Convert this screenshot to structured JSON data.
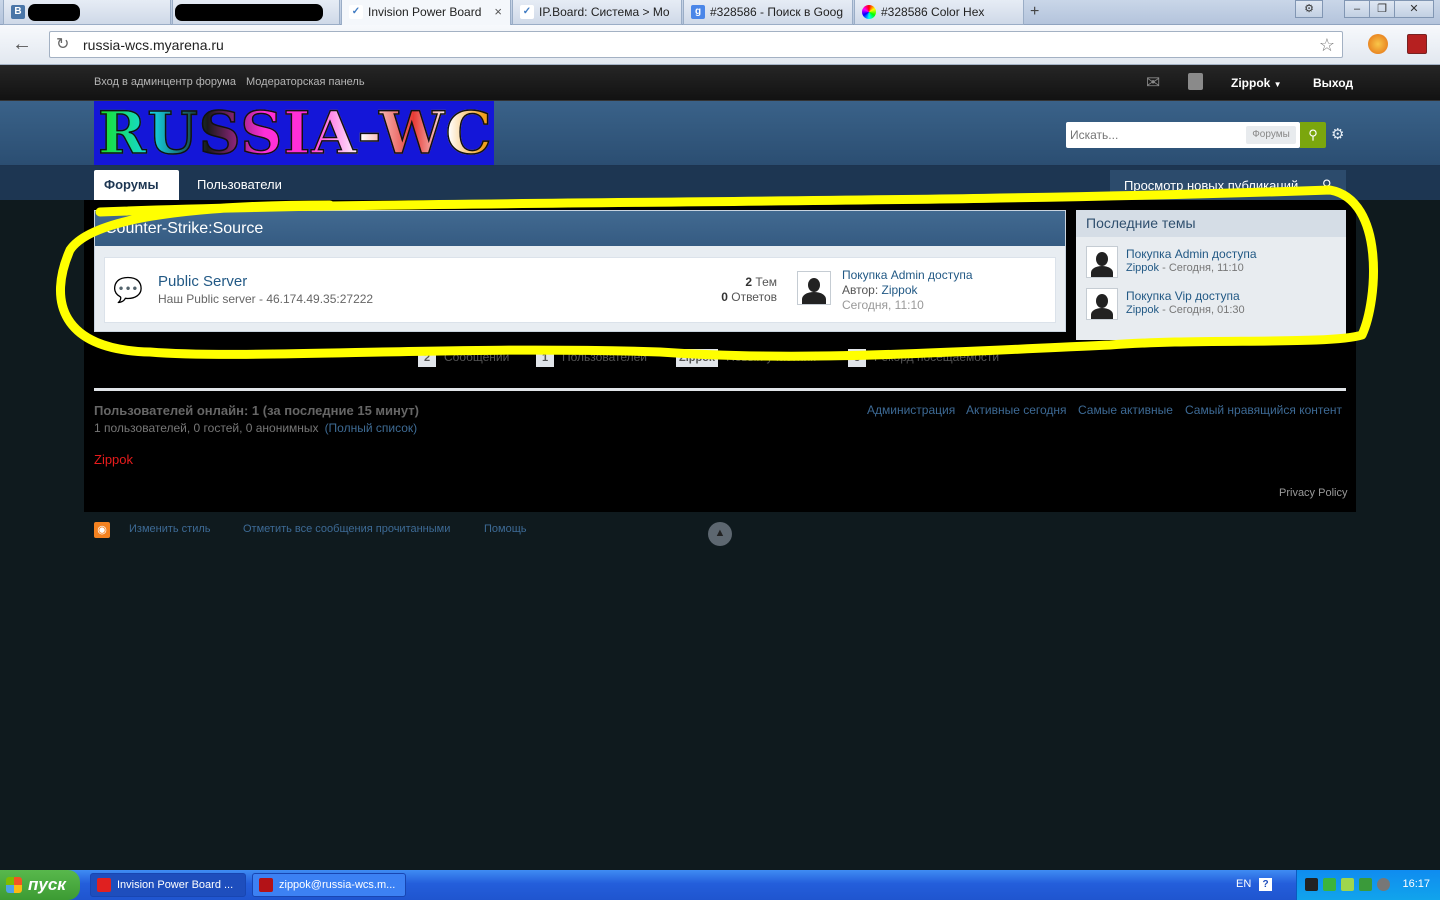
{
  "browser": {
    "tabs": [
      {
        "label": "",
        "icon": "vk-icon"
      },
      {
        "label": "",
        "icon": "redacted"
      },
      {
        "label": "Invision Power Board",
        "icon": "ipb-icon",
        "active": true
      },
      {
        "label": "IP.Board: Система > Mo",
        "icon": "ipb-icon"
      },
      {
        "label": "#328586 - Поиск в Goog",
        "icon": "google-icon"
      },
      {
        "label": "#328586 Color Hex",
        "icon": "colorhex-icon"
      }
    ],
    "tab_close": "×",
    "new_tab": "+",
    "url": "russia-wcs.myarena.ru"
  },
  "userbar": {
    "admin_link": "Вход в админцентр форума",
    "mod_link": "Модераторская панель",
    "username": "Zippok",
    "logout": "Выход"
  },
  "header": {
    "logo_text": "RUSSIA-WCS",
    "search_placeholder": "Искать...",
    "search_scope": "Форумы"
  },
  "nav": {
    "tabs": [
      "Форумы",
      "Пользователи"
    ],
    "new_content": "Просмотр новых публикаций"
  },
  "category": {
    "title": "Counter-Strike:Source",
    "forum": {
      "title": "Public Server",
      "description": "Наш Public server - 46.174.49.35:27222",
      "topics_count": "2",
      "topics_label": "Тем",
      "replies_count": "0",
      "replies_label": "Ответов",
      "last_post_title": "Покупка Admin доступа",
      "last_post_author_label": "Автор:",
      "last_post_author": "Zippok",
      "last_post_date": "Сегодня, 11:10"
    }
  },
  "sidebar": {
    "title": "Последние темы",
    "topics": [
      {
        "title": "Покупка Admin доступа",
        "author": "Zippok",
        "date": "- Сегодня, 11:10"
      },
      {
        "title": "Покупка Vip доступа",
        "author": "Zippok",
        "date": "- Сегодня, 01:30"
      }
    ]
  },
  "stats": [
    {
      "value": "2",
      "label": "Сообщений"
    },
    {
      "value": "1",
      "label": "Пользователей"
    },
    {
      "value": "Zippok",
      "label": "Новый участник"
    },
    {
      "value": "3",
      "label": "Рекорд посещаемости"
    }
  ],
  "online": {
    "title": "Пользователей онлайн: 1 (за последние 15 минут)",
    "subtitle": "1 пользователей, 0 гостей, 0 анонимных",
    "full_list": "(Полный список)",
    "user": "Zippok",
    "links": [
      "Администрация",
      "Активные сегодня",
      "Самые активные",
      "Самый нравящийся контент"
    ]
  },
  "privacy": "Privacy Policy",
  "footer": {
    "links": [
      "Изменить стиль",
      "Отметить все сообщения прочитанными",
      "Помощь"
    ]
  },
  "taskbar": {
    "start": "пуск",
    "tasks": [
      "Invision Power Board ...",
      "zippok@russia-wcs.m..."
    ],
    "lang": "EN",
    "help": "?",
    "time": "16:17"
  },
  "colors": {
    "annotation": "#ffff00",
    "forum_blue": "#225985",
    "online_user": "#e81c1c",
    "search_btn": "#7ba60d"
  }
}
